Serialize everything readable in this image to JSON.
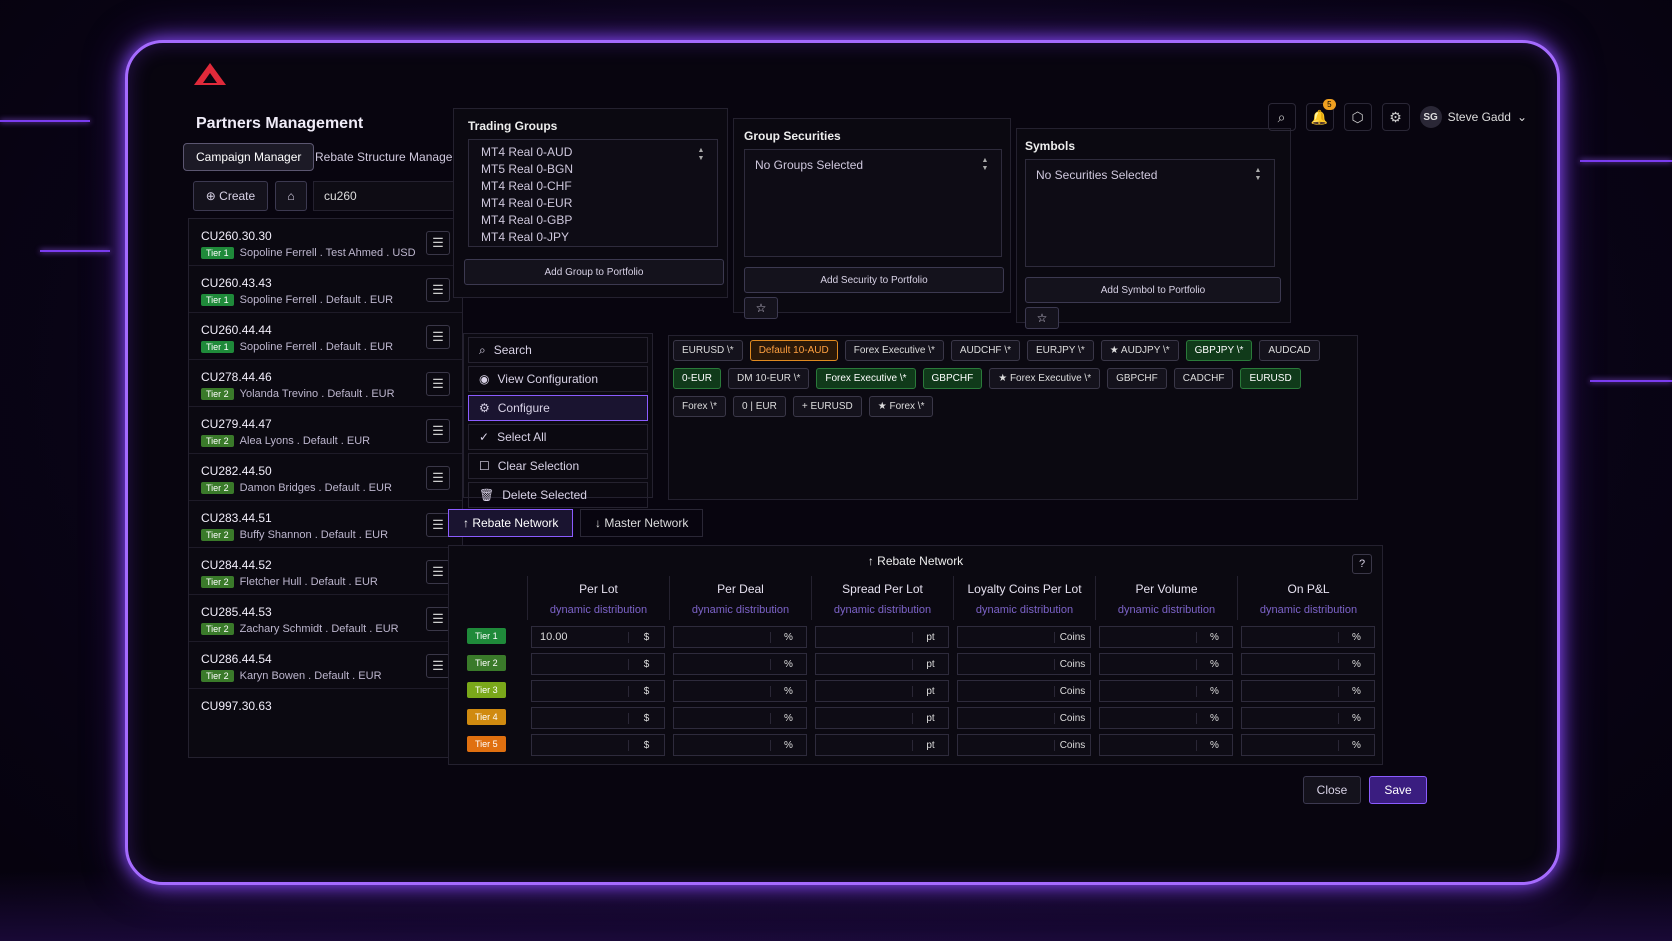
{
  "app": {
    "title": "Partners Management"
  },
  "tabs": [
    {
      "label": "Campaign Manager"
    },
    {
      "label": "Rebate Structure Manager"
    }
  ],
  "toolbar": {
    "create_label": "Create",
    "search_value": "cu260"
  },
  "partners": [
    {
      "code": "CU260.30.30",
      "tier": "Tier 1",
      "desc": "Sopoline Ferrell . Test Ahmed . USD"
    },
    {
      "code": "CU260.43.43",
      "tier": "Tier 1",
      "desc": "Sopoline Ferrell . Default . EUR"
    },
    {
      "code": "CU260.44.44",
      "tier": "Tier 1",
      "desc": "Sopoline Ferrell . Default . EUR"
    },
    {
      "code": "CU278.44.46",
      "tier": "Tier 2",
      "desc": "Yolanda Trevino . Default . EUR"
    },
    {
      "code": "CU279.44.47",
      "tier": "Tier 2",
      "desc": "Alea Lyons . Default . EUR"
    },
    {
      "code": "CU282.44.50",
      "tier": "Tier 2",
      "desc": "Damon Bridges . Default . EUR"
    },
    {
      "code": "CU283.44.51",
      "tier": "Tier 2",
      "desc": "Buffy Shannon . Default . EUR"
    },
    {
      "code": "CU284.44.52",
      "tier": "Tier 2",
      "desc": "Fletcher Hull . Default . EUR"
    },
    {
      "code": "CU285.44.53",
      "tier": "Tier 2",
      "desc": "Zachary Schmidt . Default . EUR"
    },
    {
      "code": "CU286.44.54",
      "tier": "Tier 2",
      "desc": "Karyn Bowen . Default . EUR"
    },
    {
      "code": "CU997.30.63"
    }
  ],
  "trading_groups": {
    "title": "Trading Groups",
    "items": [
      "MT4 Real 0-AUD",
      "MT5 Real 0-BGN",
      "MT4 Real 0-CHF",
      "MT4 Real 0-EUR",
      "MT4 Real 0-GBP",
      "MT4 Real 0-JPY"
    ],
    "add_label": "Add Group to Portfolio"
  },
  "group_securities": {
    "title": "Group Securities",
    "empty": "No Groups Selected",
    "add_label": "Add Security to Portfolio"
  },
  "symbols": {
    "title": "Symbols",
    "empty": "No Securities Selected",
    "add_label": "Add Symbol to Portfolio"
  },
  "user": {
    "initials": "SG",
    "name": "Steve Gadd",
    "notifications": "5"
  },
  "actions": [
    "Search",
    "View Configuration",
    "Configure",
    "Select All",
    "Clear Selection",
    "Delete Selected"
  ],
  "chips": [
    {
      "label": "EURUSD \\*",
      "style": "n"
    },
    {
      "label": "Default 10-AUD",
      "style": "or"
    },
    {
      "label": "Forex Executive \\*",
      "style": "n"
    },
    {
      "label": "AUDCHF \\*",
      "style": "n"
    },
    {
      "label": "EURJPY \\*",
      "style": "n"
    },
    {
      "label": "★ AUDJPY \\*",
      "style": "n"
    },
    {
      "label": "GBPJPY \\*",
      "style": "gr"
    },
    {
      "label": "AUDCAD",
      "style": "n"
    },
    {
      "label": "0-EUR",
      "style": "gr"
    },
    {
      "label": "DM 10-EUR \\*",
      "style": "n"
    },
    {
      "label": "Forex Executive \\*",
      "style": "gr"
    },
    {
      "label": "GBPCHF",
      "style": "gr"
    },
    {
      "label": "★ Forex Executive \\*",
      "style": "n"
    },
    {
      "label": "GBPCHF",
      "style": "n"
    },
    {
      "label": "CADCHF",
      "style": "n"
    },
    {
      "label": "EURUSD",
      "style": "gr"
    },
    {
      "label": "Forex \\*",
      "style": "n"
    },
    {
      "label": "0 | EUR",
      "style": "n"
    },
    {
      "label": "+ EURUSD",
      "style": "n"
    },
    {
      "label": "★ Forex \\*",
      "style": "n"
    }
  ],
  "network_tabs": [
    "↑ Rebate Network",
    "↓ Master Network"
  ],
  "rebate": {
    "title": "↑ Rebate Network",
    "columns": [
      {
        "name": "Per Lot",
        "sub": "dynamic distribution",
        "unit": "$"
      },
      {
        "name": "Per Deal",
        "sub": "dynamic distribution",
        "unit": "%"
      },
      {
        "name": "Spread Per Lot",
        "sub": "dynamic distribution",
        "unit": "pt"
      },
      {
        "name": "Loyalty Coins Per Lot",
        "sub": "dynamic distribution",
        "unit": "Coins"
      },
      {
        "name": "Per Volume",
        "sub": "dynamic distribution",
        "unit": "%"
      },
      {
        "name": "On P&L",
        "sub": "dynamic distribution",
        "unit": "%"
      }
    ],
    "tiers": [
      {
        "label": "Tier 1",
        "first": "10.00"
      },
      {
        "label": "Tier 2",
        "first": ""
      },
      {
        "label": "Tier 3",
        "first": ""
      },
      {
        "label": "Tier 4",
        "first": ""
      },
      {
        "label": "Tier 5",
        "first": ""
      }
    ]
  },
  "footer": {
    "close": "Close",
    "save": "Save"
  },
  "colors": {
    "accent": "#8b5cff",
    "tier1": "#1f8a3a",
    "tier2": "#3a7a2a",
    "tier3": "#7aa81a",
    "tier4": "#d08a10",
    "tier5": "#e07010"
  }
}
